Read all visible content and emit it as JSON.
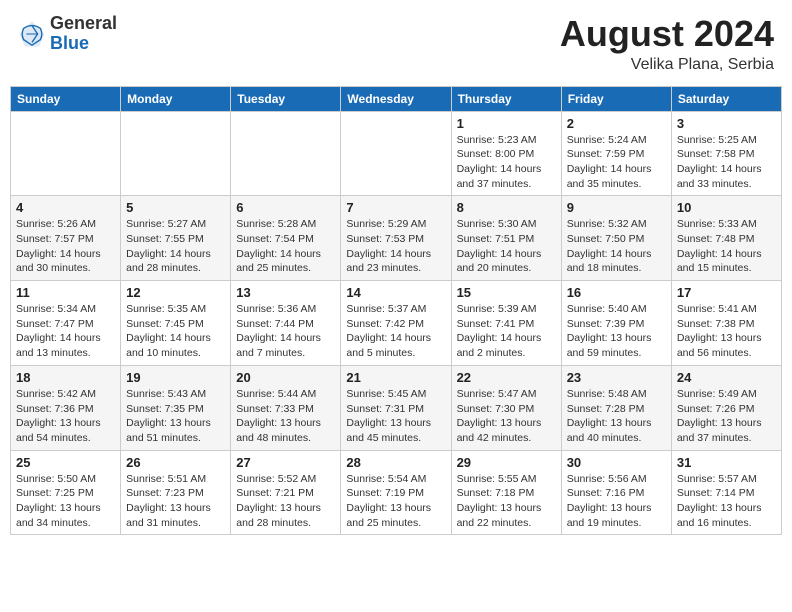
{
  "header": {
    "logo_general": "General",
    "logo_blue": "Blue",
    "month": "August 2024",
    "location": "Velika Plana, Serbia"
  },
  "days_of_week": [
    "Sunday",
    "Monday",
    "Tuesday",
    "Wednesday",
    "Thursday",
    "Friday",
    "Saturday"
  ],
  "weeks": [
    [
      {
        "day": "",
        "info": ""
      },
      {
        "day": "",
        "info": ""
      },
      {
        "day": "",
        "info": ""
      },
      {
        "day": "",
        "info": ""
      },
      {
        "day": "1",
        "info": "Sunrise: 5:23 AM\nSunset: 8:00 PM\nDaylight: 14 hours\nand 37 minutes."
      },
      {
        "day": "2",
        "info": "Sunrise: 5:24 AM\nSunset: 7:59 PM\nDaylight: 14 hours\nand 35 minutes."
      },
      {
        "day": "3",
        "info": "Sunrise: 5:25 AM\nSunset: 7:58 PM\nDaylight: 14 hours\nand 33 minutes."
      }
    ],
    [
      {
        "day": "4",
        "info": "Sunrise: 5:26 AM\nSunset: 7:57 PM\nDaylight: 14 hours\nand 30 minutes."
      },
      {
        "day": "5",
        "info": "Sunrise: 5:27 AM\nSunset: 7:55 PM\nDaylight: 14 hours\nand 28 minutes."
      },
      {
        "day": "6",
        "info": "Sunrise: 5:28 AM\nSunset: 7:54 PM\nDaylight: 14 hours\nand 25 minutes."
      },
      {
        "day": "7",
        "info": "Sunrise: 5:29 AM\nSunset: 7:53 PM\nDaylight: 14 hours\nand 23 minutes."
      },
      {
        "day": "8",
        "info": "Sunrise: 5:30 AM\nSunset: 7:51 PM\nDaylight: 14 hours\nand 20 minutes."
      },
      {
        "day": "9",
        "info": "Sunrise: 5:32 AM\nSunset: 7:50 PM\nDaylight: 14 hours\nand 18 minutes."
      },
      {
        "day": "10",
        "info": "Sunrise: 5:33 AM\nSunset: 7:48 PM\nDaylight: 14 hours\nand 15 minutes."
      }
    ],
    [
      {
        "day": "11",
        "info": "Sunrise: 5:34 AM\nSunset: 7:47 PM\nDaylight: 14 hours\nand 13 minutes."
      },
      {
        "day": "12",
        "info": "Sunrise: 5:35 AM\nSunset: 7:45 PM\nDaylight: 14 hours\nand 10 minutes."
      },
      {
        "day": "13",
        "info": "Sunrise: 5:36 AM\nSunset: 7:44 PM\nDaylight: 14 hours\nand 7 minutes."
      },
      {
        "day": "14",
        "info": "Sunrise: 5:37 AM\nSunset: 7:42 PM\nDaylight: 14 hours\nand 5 minutes."
      },
      {
        "day": "15",
        "info": "Sunrise: 5:39 AM\nSunset: 7:41 PM\nDaylight: 14 hours\nand 2 minutes."
      },
      {
        "day": "16",
        "info": "Sunrise: 5:40 AM\nSunset: 7:39 PM\nDaylight: 13 hours\nand 59 minutes."
      },
      {
        "day": "17",
        "info": "Sunrise: 5:41 AM\nSunset: 7:38 PM\nDaylight: 13 hours\nand 56 minutes."
      }
    ],
    [
      {
        "day": "18",
        "info": "Sunrise: 5:42 AM\nSunset: 7:36 PM\nDaylight: 13 hours\nand 54 minutes."
      },
      {
        "day": "19",
        "info": "Sunrise: 5:43 AM\nSunset: 7:35 PM\nDaylight: 13 hours\nand 51 minutes."
      },
      {
        "day": "20",
        "info": "Sunrise: 5:44 AM\nSunset: 7:33 PM\nDaylight: 13 hours\nand 48 minutes."
      },
      {
        "day": "21",
        "info": "Sunrise: 5:45 AM\nSunset: 7:31 PM\nDaylight: 13 hours\nand 45 minutes."
      },
      {
        "day": "22",
        "info": "Sunrise: 5:47 AM\nSunset: 7:30 PM\nDaylight: 13 hours\nand 42 minutes."
      },
      {
        "day": "23",
        "info": "Sunrise: 5:48 AM\nSunset: 7:28 PM\nDaylight: 13 hours\nand 40 minutes."
      },
      {
        "day": "24",
        "info": "Sunrise: 5:49 AM\nSunset: 7:26 PM\nDaylight: 13 hours\nand 37 minutes."
      }
    ],
    [
      {
        "day": "25",
        "info": "Sunrise: 5:50 AM\nSunset: 7:25 PM\nDaylight: 13 hours\nand 34 minutes."
      },
      {
        "day": "26",
        "info": "Sunrise: 5:51 AM\nSunset: 7:23 PM\nDaylight: 13 hours\nand 31 minutes."
      },
      {
        "day": "27",
        "info": "Sunrise: 5:52 AM\nSunset: 7:21 PM\nDaylight: 13 hours\nand 28 minutes."
      },
      {
        "day": "28",
        "info": "Sunrise: 5:54 AM\nSunset: 7:19 PM\nDaylight: 13 hours\nand 25 minutes."
      },
      {
        "day": "29",
        "info": "Sunrise: 5:55 AM\nSunset: 7:18 PM\nDaylight: 13 hours\nand 22 minutes."
      },
      {
        "day": "30",
        "info": "Sunrise: 5:56 AM\nSunset: 7:16 PM\nDaylight: 13 hours\nand 19 minutes."
      },
      {
        "day": "31",
        "info": "Sunrise: 5:57 AM\nSunset: 7:14 PM\nDaylight: 13 hours\nand 16 minutes."
      }
    ]
  ]
}
